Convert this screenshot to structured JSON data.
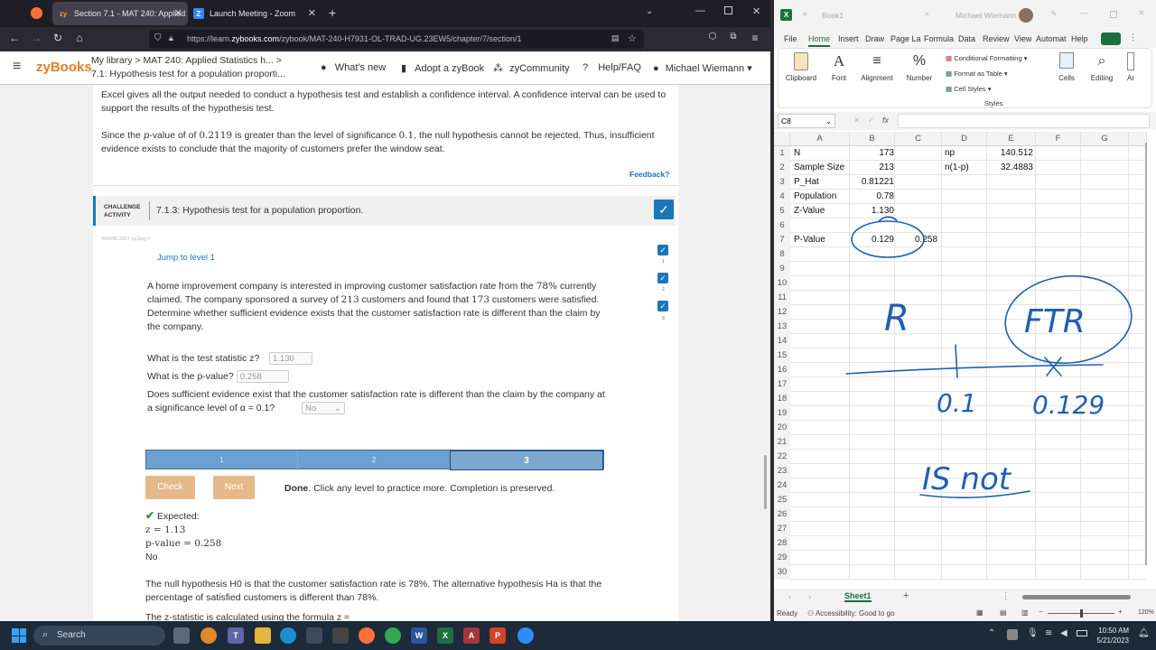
{
  "browser": {
    "tabs": [
      {
        "label": "Section 7.1 - MAT 240: Applied",
        "icon": "zybooks-icon",
        "active": true
      },
      {
        "label": "Launch Meeting - Zoom",
        "icon": "zoom-icon",
        "active": false
      }
    ],
    "new_tab": "+",
    "url_prefix": "https://learn.",
    "url_domain": "zybooks.com",
    "url_rest": "/zybook/MAT-240-H7931-OL-TRAD-UG.23EW5/chapter/7/section/1"
  },
  "zybooks": {
    "logo": "zyBooks",
    "breadcrumb_top": "My library > MAT 240: Applied Statistics h...  >",
    "breadcrumb_bottom": "7.1: Hypothesis test for a population proporti...",
    "nav": [
      "What's new",
      "Adopt a zyBook",
      "zyCommunity",
      "Help/FAQ",
      "Michael Wiemann"
    ],
    "intro_p1": "Excel gives all the output needed to conduct a hypothesis test and establish a confidence interval. A confidence interval can be used to support the results of the hypothesis test.",
    "intro_p2a": "Since the ",
    "intro_p2_p": "p",
    "intro_p2b": "-value of of ",
    "intro_p2_val": "0.2119",
    "intro_p2c": " is greater than the level of significance ",
    "intro_p2_alpha": "0.1",
    "intro_p2d": ", the null hypothesis cannot be rejected. Thus, insufficient evidence exists to conclude that the majority of customers prefer the window seat.",
    "feedback": "Feedback?",
    "challenge_label_1": "CHALLENGE",
    "challenge_label_2": "ACTIVITY",
    "challenge_title": "7.1.3: Hypothesis test for a population proportion.",
    "activity_id": "486090.3207.qx3zqy7",
    "jump": "Jump to level 1",
    "level_marks": [
      "1",
      "2",
      "3"
    ],
    "problem_a": "A home improvement company is interested in improving customer satisfaction rate from the ",
    "problem_pct": "78%",
    "problem_b": " currently claimed. The company sponsored a survey of ",
    "problem_n": "213",
    "problem_c": " customers and found that ",
    "problem_x": "173",
    "problem_d": " customers were satisfied. Determine whether sufficient evidence exists that the customer satisfaction rate is different than the claim by the company.",
    "q1_label": "What is the test statistic z?",
    "q1_value": "1.130",
    "q2_label": "What is the p-value?",
    "q2_value": "0.258",
    "q3_label_a": "Does sufficient evidence exist that the customer satisfaction rate is different than the claim by the company at a significance level of α = 0.1?",
    "q3_value": "No",
    "progress": [
      "1",
      "2",
      "3"
    ],
    "check_btn": "Check",
    "next_btn": "Next",
    "done_bold": "Done",
    "done_text": ". Click any level to practice more. Completion is preserved.",
    "expected": "Expected:",
    "exp_z": "z = 1.13",
    "exp_p": "p-value = 0.258",
    "exp_no": "No",
    "expl_1": "The null hypothesis H0 is that the customer satisfaction rate is 78%. The alternative hypothesis Ha is that the percentage of satisfied customers is different than 78%.",
    "expl_2": "The z-statistic is calculated using the formula z = "
  },
  "excel": {
    "title": "Book1",
    "user": "Michael Wiemann",
    "menu": [
      "File",
      "Home",
      "Insert",
      "Draw",
      "Page La",
      "Formula",
      "Data",
      "Review",
      "View",
      "Automat",
      "Help"
    ],
    "ribbon": {
      "clipboard": "Clipboard",
      "font": "Font",
      "alignment": "Alignment",
      "number": "Number",
      "cond_format": "Conditional Formatting",
      "format_table": "Format as Table",
      "cell_styles": "Cell Styles",
      "styles": "Styles",
      "cells": "Cells",
      "editing": "Editing",
      "more": "Ar"
    },
    "name_box": "C8",
    "fx": "fx",
    "columns": [
      "A",
      "B",
      "C",
      "D",
      "E",
      "F",
      "G"
    ],
    "rows": [
      "1",
      "2",
      "3",
      "4",
      "5",
      "6",
      "7",
      "8",
      "9",
      "10",
      "11",
      "12",
      "13",
      "14",
      "15",
      "16",
      "17",
      "18",
      "19",
      "20",
      "21",
      "22",
      "23",
      "24",
      "25",
      "26",
      "27",
      "28",
      "29",
      "30"
    ],
    "cells": {
      "A1": "N",
      "B1": "173",
      "D1": "np",
      "E1": "140.512",
      "A2": "Sample Size",
      "B2": "213",
      "D2": "n(1-p)",
      "E2": "32.4883",
      "A3": "P_Hat",
      "B3": "0.81221",
      "A4": "Population",
      "B4": "0.78",
      "A5": "Z-Value",
      "B5": "1.130",
      "A7": "P-Value",
      "B7": "0.129",
      "C7": "0.258"
    },
    "ink": {
      "r": "R",
      "ftr": "FTR",
      "alpha": "0.1",
      "p": "0.129",
      "isnot": "IS not"
    },
    "sheet": "Sheet1",
    "status_ready": "Ready",
    "status_access": "Accessibility: Good to go",
    "zoom": "120%"
  },
  "taskbar": {
    "search": "Search",
    "time": "10:50 AM",
    "date": "5/21/2023"
  }
}
